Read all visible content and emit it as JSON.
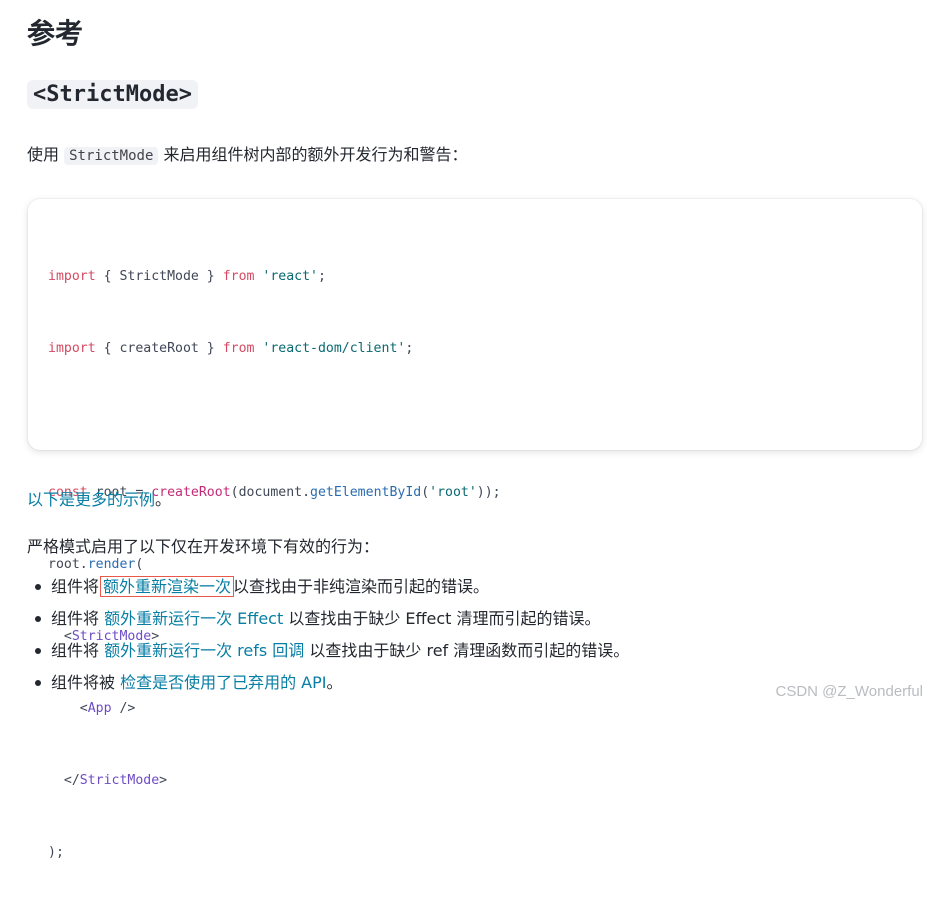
{
  "heading": "参考",
  "section_code": "<StrictMode>",
  "intro": {
    "prefix": "使用",
    "code": "StrictMode",
    "suffix": "来启用组件树内部的额外开发行为和警告："
  },
  "code_lines": {
    "l1": {
      "a": "import",
      "b": " { StrictMode } ",
      "c": "from",
      "d": " ",
      "e": "'react'",
      "f": ";"
    },
    "l2": {
      "a": "import",
      "b": " { createRoot } ",
      "c": "from",
      "d": " ",
      "e": "'react-dom/client'",
      "f": ";"
    },
    "l4": {
      "a": "const",
      "b": " root = ",
      "c": "createRoot",
      "d": "(document.",
      "e": "getElementById",
      "f": "(",
      "g": "'root'",
      "h": "));"
    },
    "l5": {
      "a": "root.",
      "b": "render",
      "c": "("
    },
    "l6": {
      "a": "  <",
      "b": "StrictMode",
      "c": ">"
    },
    "l7": {
      "a": "    <",
      "b": "App",
      "c": " />"
    },
    "l8": {
      "a": "  </",
      "b": "StrictMode",
      "c": ">"
    },
    "l9": {
      "a": ");"
    }
  },
  "more_examples": {
    "link": "以下是更多的示例",
    "tail": "。"
  },
  "strict_intro": "严格模式启用了以下仅在开发环境下有效的行为：",
  "list": [
    {
      "prefix": "组件将",
      "link": "额外重新渲染一次",
      "suffix": "以查找由于非纯渲染而引起的错误。"
    },
    {
      "prefix": "组件将 ",
      "link": "额外重新运行一次 Effect",
      "suffix": " 以查找由于缺少 Effect 清理而引起的错误。"
    },
    {
      "prefix": "组件将 ",
      "link": "额外重新运行一次 refs 回调",
      "suffix": " 以查找由于缺少 ref 清理函数而引起的错误。"
    },
    {
      "prefix": "组件将被 ",
      "link": "检查是否使用了已弃用的 API",
      "suffix": "。"
    }
  ],
  "watermark": "CSDN @Z_Wonderful",
  "colors": {
    "link": "#087ea4",
    "highlight_box": "#e8594a",
    "keyword": "#d44a62",
    "string": "#0a6970"
  }
}
